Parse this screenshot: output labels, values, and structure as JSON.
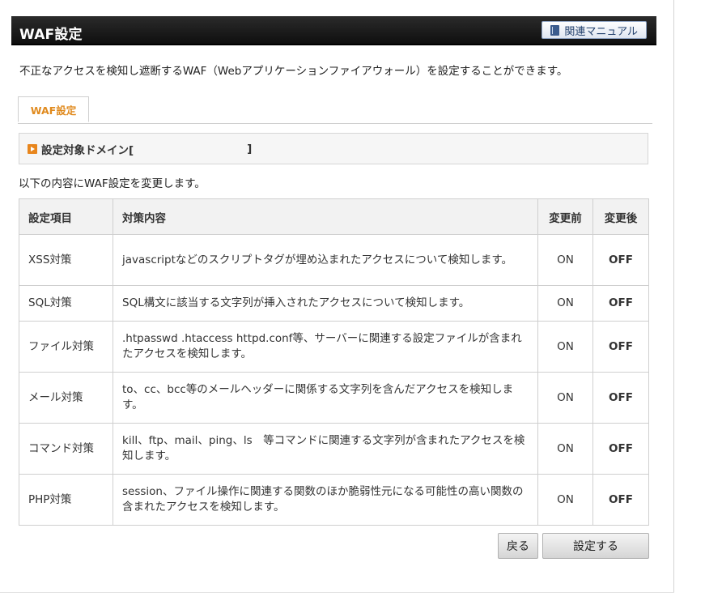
{
  "header": {
    "title": "WAF設定",
    "manual_button": "関連マニュアル"
  },
  "intro_text": "不正なアクセスを検知し遮断するWAF（Webアプリケーションファイアウォール）を設定することができます。",
  "tab": {
    "label": "WAF設定"
  },
  "domain": {
    "prefix": "設定対象ドメイン[",
    "suffix": "]"
  },
  "sub_intro": "以下の内容にWAF設定を変更します。",
  "table": {
    "headers": [
      "設定項目",
      "対策内容",
      "変更前",
      "変更後"
    ],
    "rows": [
      {
        "item": "XSS対策",
        "desc": "javascriptなどのスクリプトタグが埋め込まれたアクセスについて検知します。",
        "before": "ON",
        "after": "OFF"
      },
      {
        "item": "SQL対策",
        "desc": "SQL構文に該当する文字列が挿入されたアクセスについて検知します。",
        "before": "ON",
        "after": "OFF"
      },
      {
        "item": "ファイル対策",
        "desc": ".htpasswd .htaccess httpd.conf等、サーバーに関連する設定ファイルが含まれたアクセスを検知します。",
        "before": "ON",
        "after": "OFF"
      },
      {
        "item": "メール対策",
        "desc": "to、cc、bcc等のメールヘッダーに関係する文字列を含んだアクセスを検知します。",
        "before": "ON",
        "after": "OFF"
      },
      {
        "item": "コマンド対策",
        "desc": "kill、ftp、mail、ping、ls　等コマンドに関連する文字列が含まれたアクセスを検知します。",
        "before": "ON",
        "after": "OFF"
      },
      {
        "item": "PHP対策",
        "desc": "session、ファイル操作に関連する関数のほか脆弱性元になる可能性の高い関数の含まれたアクセスを検知します。",
        "before": "ON",
        "after": "OFF"
      }
    ]
  },
  "buttons": {
    "back": "戻る",
    "submit": "設定する"
  }
}
